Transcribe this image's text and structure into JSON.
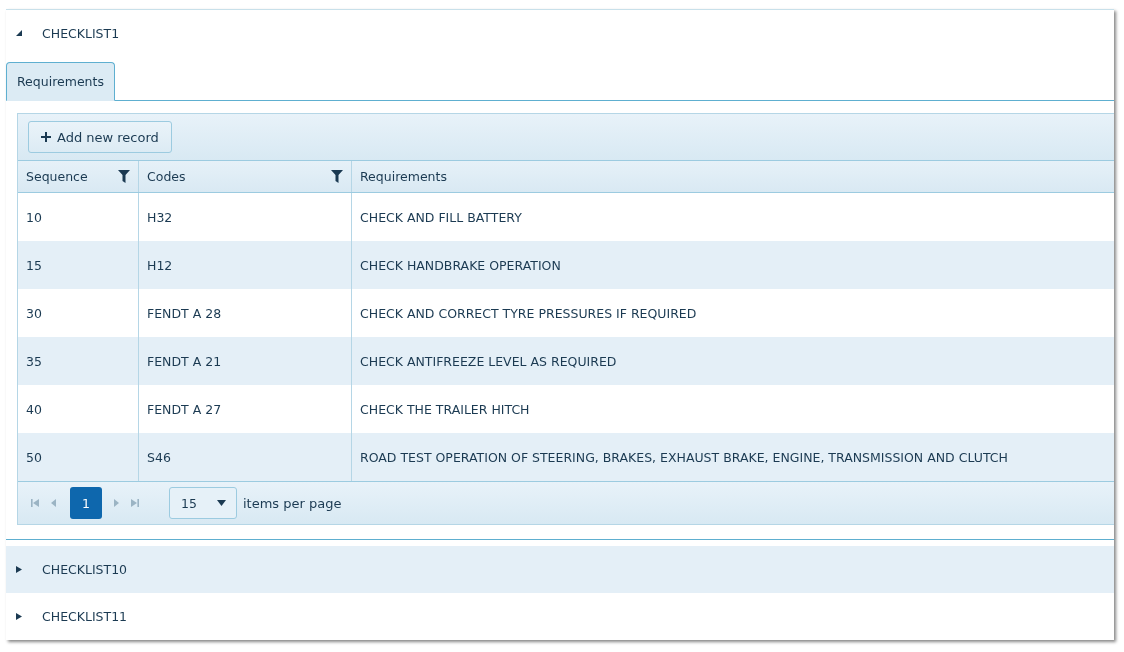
{
  "panels": [
    {
      "title": "CHECKLIST1",
      "expanded": true,
      "tabs": [
        {
          "label": "Requirements",
          "selected": true
        }
      ],
      "grid": {
        "toolbar_button": "Add new record",
        "columns": [
          {
            "title": "Sequence",
            "filter": true
          },
          {
            "title": "Codes",
            "filter": true
          },
          {
            "title": "Requirements",
            "filter": false
          }
        ],
        "rows": [
          [
            "10",
            "H32",
            "CHECK AND FILL BATTERY"
          ],
          [
            "15",
            "H12",
            "CHECK HANDBRAKE OPERATION"
          ],
          [
            "30",
            "FENDT A 28",
            "CHECK AND CORRECT TYRE PRESSURES IF REQUIRED"
          ],
          [
            "35",
            "FENDT A 21",
            "CHECK ANTIFREEZE LEVEL AS REQUIRED"
          ],
          [
            "40",
            "FENDT A 27",
            "CHECK THE TRAILER HITCH"
          ],
          [
            "50",
            "S46",
            "ROAD TEST OPERATION OF STEERING, BRAKES, EXHAUST BRAKE, ENGINE, TRANSMISSION AND CLUTCH"
          ]
        ],
        "pager": {
          "pages": [
            {
              "label": "1",
              "selected": true
            }
          ],
          "page_size": "15",
          "page_size_label": "items per page"
        }
      }
    },
    {
      "title": "CHECKLIST10",
      "expanded": false
    },
    {
      "title": "CHECKLIST11",
      "expanded": false
    }
  ]
}
